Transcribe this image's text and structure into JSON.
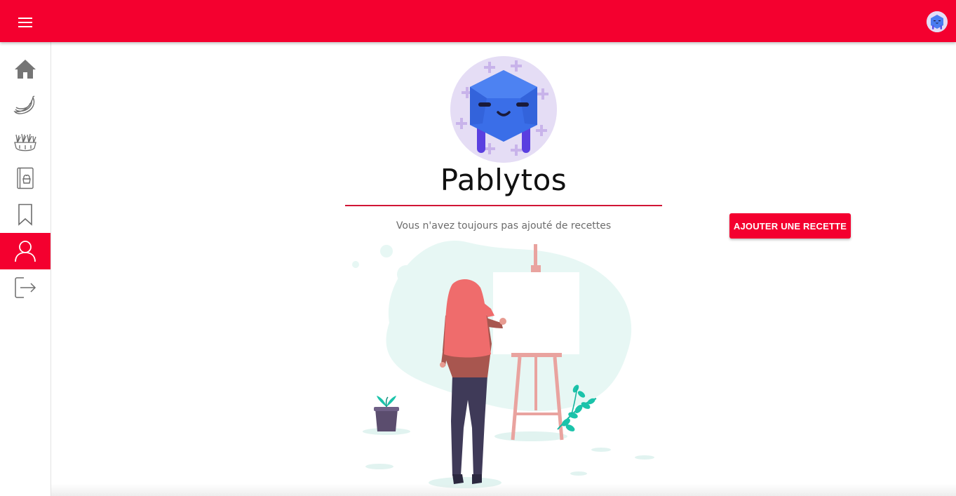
{
  "header": {
    "menu_icon": "hamburger-menu-icon",
    "avatar_icon": "user-avatar-monster-icon",
    "background_color": "#f4002f"
  },
  "sidebar": {
    "items": [
      {
        "icon": "home-icon",
        "active": false
      },
      {
        "icon": "bananas-icon",
        "active": false
      },
      {
        "icon": "vegetables-icon",
        "active": false
      },
      {
        "icon": "recipe-book-icon",
        "active": false
      },
      {
        "icon": "bookmark-icon",
        "active": false
      },
      {
        "icon": "user-icon",
        "active": true
      },
      {
        "icon": "logout-icon",
        "active": false
      }
    ]
  },
  "profile": {
    "username": "Pablytos",
    "empty_message": "Vous n'avez toujours pas ajouté de recettes",
    "add_recipe_label": "AJOUTER UNE RECETTE",
    "accent_color": "#f4002f"
  }
}
